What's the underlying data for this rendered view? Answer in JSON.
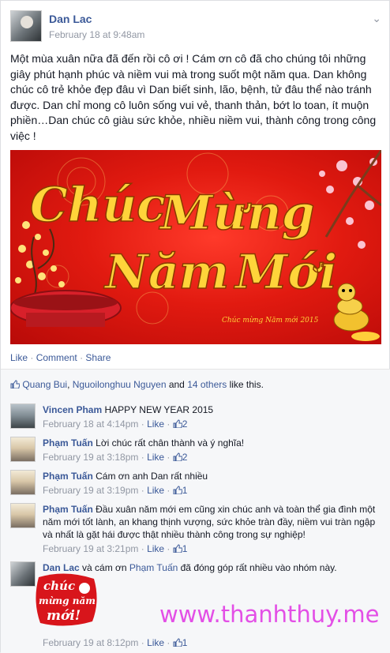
{
  "post": {
    "author": "Dan Lac",
    "timestamp": "February 18 at 9:48am",
    "text": "Một mùa xuân nữa đã đến rồi cô ơi ! Cám ơn cô đã cho chúng tôi những giây phút hạnh phúc và niềm vui mà trong suốt một năm qua. Dan không chúc cô trẻ khỏe đẹp đâu vì Dan biết sinh, lão, bệnh, tử đâu thể nào tránh được. Dan chỉ mong cô luôn sống vui vẻ, thanh thản, bớt lo toan, ít muộn phiền…Dan chúc cô giàu sức khỏe, nhiều niềm vui, thành công trong công việc !",
    "banner_text": [
      "Chúc",
      "Mừng",
      "Năm",
      "Mới"
    ],
    "banner_caption": "Chúc mừng Năm mới 2015"
  },
  "actions": {
    "like": "Like",
    "comment": "Comment",
    "share": "Share",
    "sep": "·"
  },
  "likes": {
    "user1": "Quang Bui",
    "sep1": ", ",
    "user2": "Nguoilonghuu Nguyen",
    "and": " and ",
    "others": "14 others",
    "suffix": " like this."
  },
  "comments": [
    {
      "name": "Vincen Pham",
      "text": "HAPPY NEW YEAR 2015",
      "time": "February 18 at 4:14pm",
      "like": "Like",
      "count": "2"
    },
    {
      "name": "Phạm Tuấn",
      "text": "Lời chúc rất chân thành và ý nghĩa!",
      "time": "February 19 at 3:18pm",
      "like": "Like",
      "count": "2"
    },
    {
      "name": "Phạm Tuấn",
      "text": "Cám ơn anh Dan rất nhiều",
      "time": "February 19 at 3:19pm",
      "like": "Like",
      "count": "1"
    },
    {
      "name": "Phạm Tuấn",
      "text": "Đầu xuân năm mới em cũng xin chúc anh và toàn thể gia đình một năm mới tốt lành, an khang thịnh vượng, sức khỏe tràn đầy, niềm vui tràn ngập và nhất là gặt hái được thật nhiều thành công trong sự nghiệp!",
      "time": "February 19 at 3:21pm",
      "like": "Like",
      "count": "1"
    },
    {
      "name": "Dan Lac",
      "text_before": " và cám ơn ",
      "mention": "Phạm Tuấn",
      "text_after": " đã đóng góp rất nhiều vào nhóm này.",
      "time": "February 19 at 8:12pm",
      "like": "Like",
      "count": "1"
    }
  ],
  "sticker_text": [
    "chúc",
    "mừng năm",
    "mới!"
  ],
  "watermark": "www.thanhthuy.me",
  "colors": {
    "link": "#3b5998",
    "meta": "#9197a3",
    "watermark": "#e34fe6",
    "banner_red": "#e11a10",
    "banner_gold": "#ffd43a"
  }
}
